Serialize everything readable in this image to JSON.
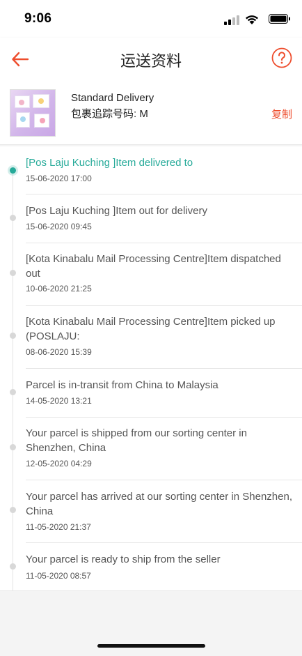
{
  "status_bar": {
    "time": "9:06",
    "icons": [
      "signal-icon",
      "wifi-icon",
      "battery-icon"
    ]
  },
  "header": {
    "title": "运送资料",
    "back_icon": "arrow-left-icon",
    "help_icon": "question-circle-icon",
    "accent_color": "#ee4d2d"
  },
  "summary": {
    "delivery_method": "Standard Delivery",
    "tracking_label": "包裹追踪号码: M",
    "copy_label": "复制"
  },
  "timeline": {
    "active_color": "#26aa99",
    "events": [
      {
        "desc": "[Pos Laju Kuching ]Item delivered to",
        "time": "15-06-2020 17:00",
        "active": true
      },
      {
        "desc": "[Pos Laju Kuching ]Item out for delivery",
        "time": "15-06-2020 09:45",
        "active": false
      },
      {
        "desc": "[Kota Kinabalu Mail Processing Centre]Item dispatched out",
        "time": "10-06-2020 21:25",
        "active": false
      },
      {
        "desc": "[Kota Kinabalu Mail Processing Centre]Item picked up (POSLAJU:",
        "time": "08-06-2020 15:39",
        "active": false
      },
      {
        "desc": "Parcel is in-transit from China to Malaysia",
        "time": "14-05-2020 13:21",
        "active": false
      },
      {
        "desc": "Your parcel is shipped from our sorting center in Shenzhen, China",
        "time": "12-05-2020 04:29",
        "active": false
      },
      {
        "desc": "Your parcel has arrived at our sorting center in Shenzhen, China",
        "time": "11-05-2020 21:37",
        "active": false
      },
      {
        "desc": "Your parcel is ready to ship from the seller",
        "time": "11-05-2020 08:57",
        "active": false
      }
    ]
  }
}
